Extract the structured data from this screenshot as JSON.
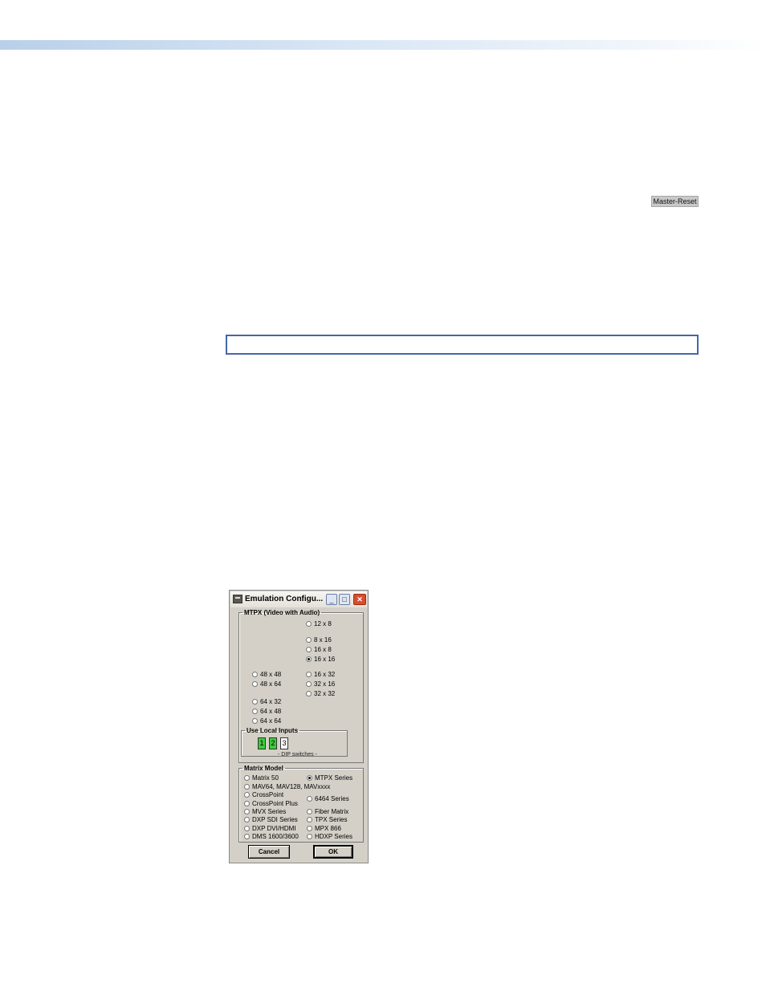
{
  "page": {
    "master_reset_label": "Master-Reset"
  },
  "dialog": {
    "title": "Emulation Configu...",
    "window_buttons": {
      "minimize": "_",
      "maximize": "□",
      "close": "✕"
    },
    "mtpx_group": {
      "legend": "MTPX  (Video with Audio)",
      "options": [
        "12 x 8",
        "8 x 16",
        "16 x 8",
        "16 x 16",
        "48 x 48",
        "48 x 64",
        "16 x 32",
        "32 x 16",
        "32 x 32",
        "64 x 32",
        "64 x 48",
        "64 x 64"
      ],
      "selected": "16 x 16"
    },
    "local_inputs": {
      "legend": "Use Local Inputs",
      "switches": [
        "1",
        "2",
        "3"
      ],
      "switches_on": [
        true,
        true,
        false
      ],
      "caption": "- DIP switches -"
    },
    "matrix_model": {
      "legend": "Matrix Model",
      "options": [
        "Matrix 50",
        "MTPX Series",
        "MAV64, MAV128, MAVxxxx",
        "CrossPoint",
        "CrossPoint Plus",
        "6464 Series",
        "MVX Series",
        "Fiber Matrix",
        "DXP SDI Series",
        "TPX Series",
        "DXP DVI/HDMI",
        "MPX 866",
        "DMS 1600/3600",
        "HDXP Series"
      ],
      "selected": "MTPX Series"
    },
    "buttons": {
      "cancel": "Cancel",
      "ok": "OK"
    }
  }
}
